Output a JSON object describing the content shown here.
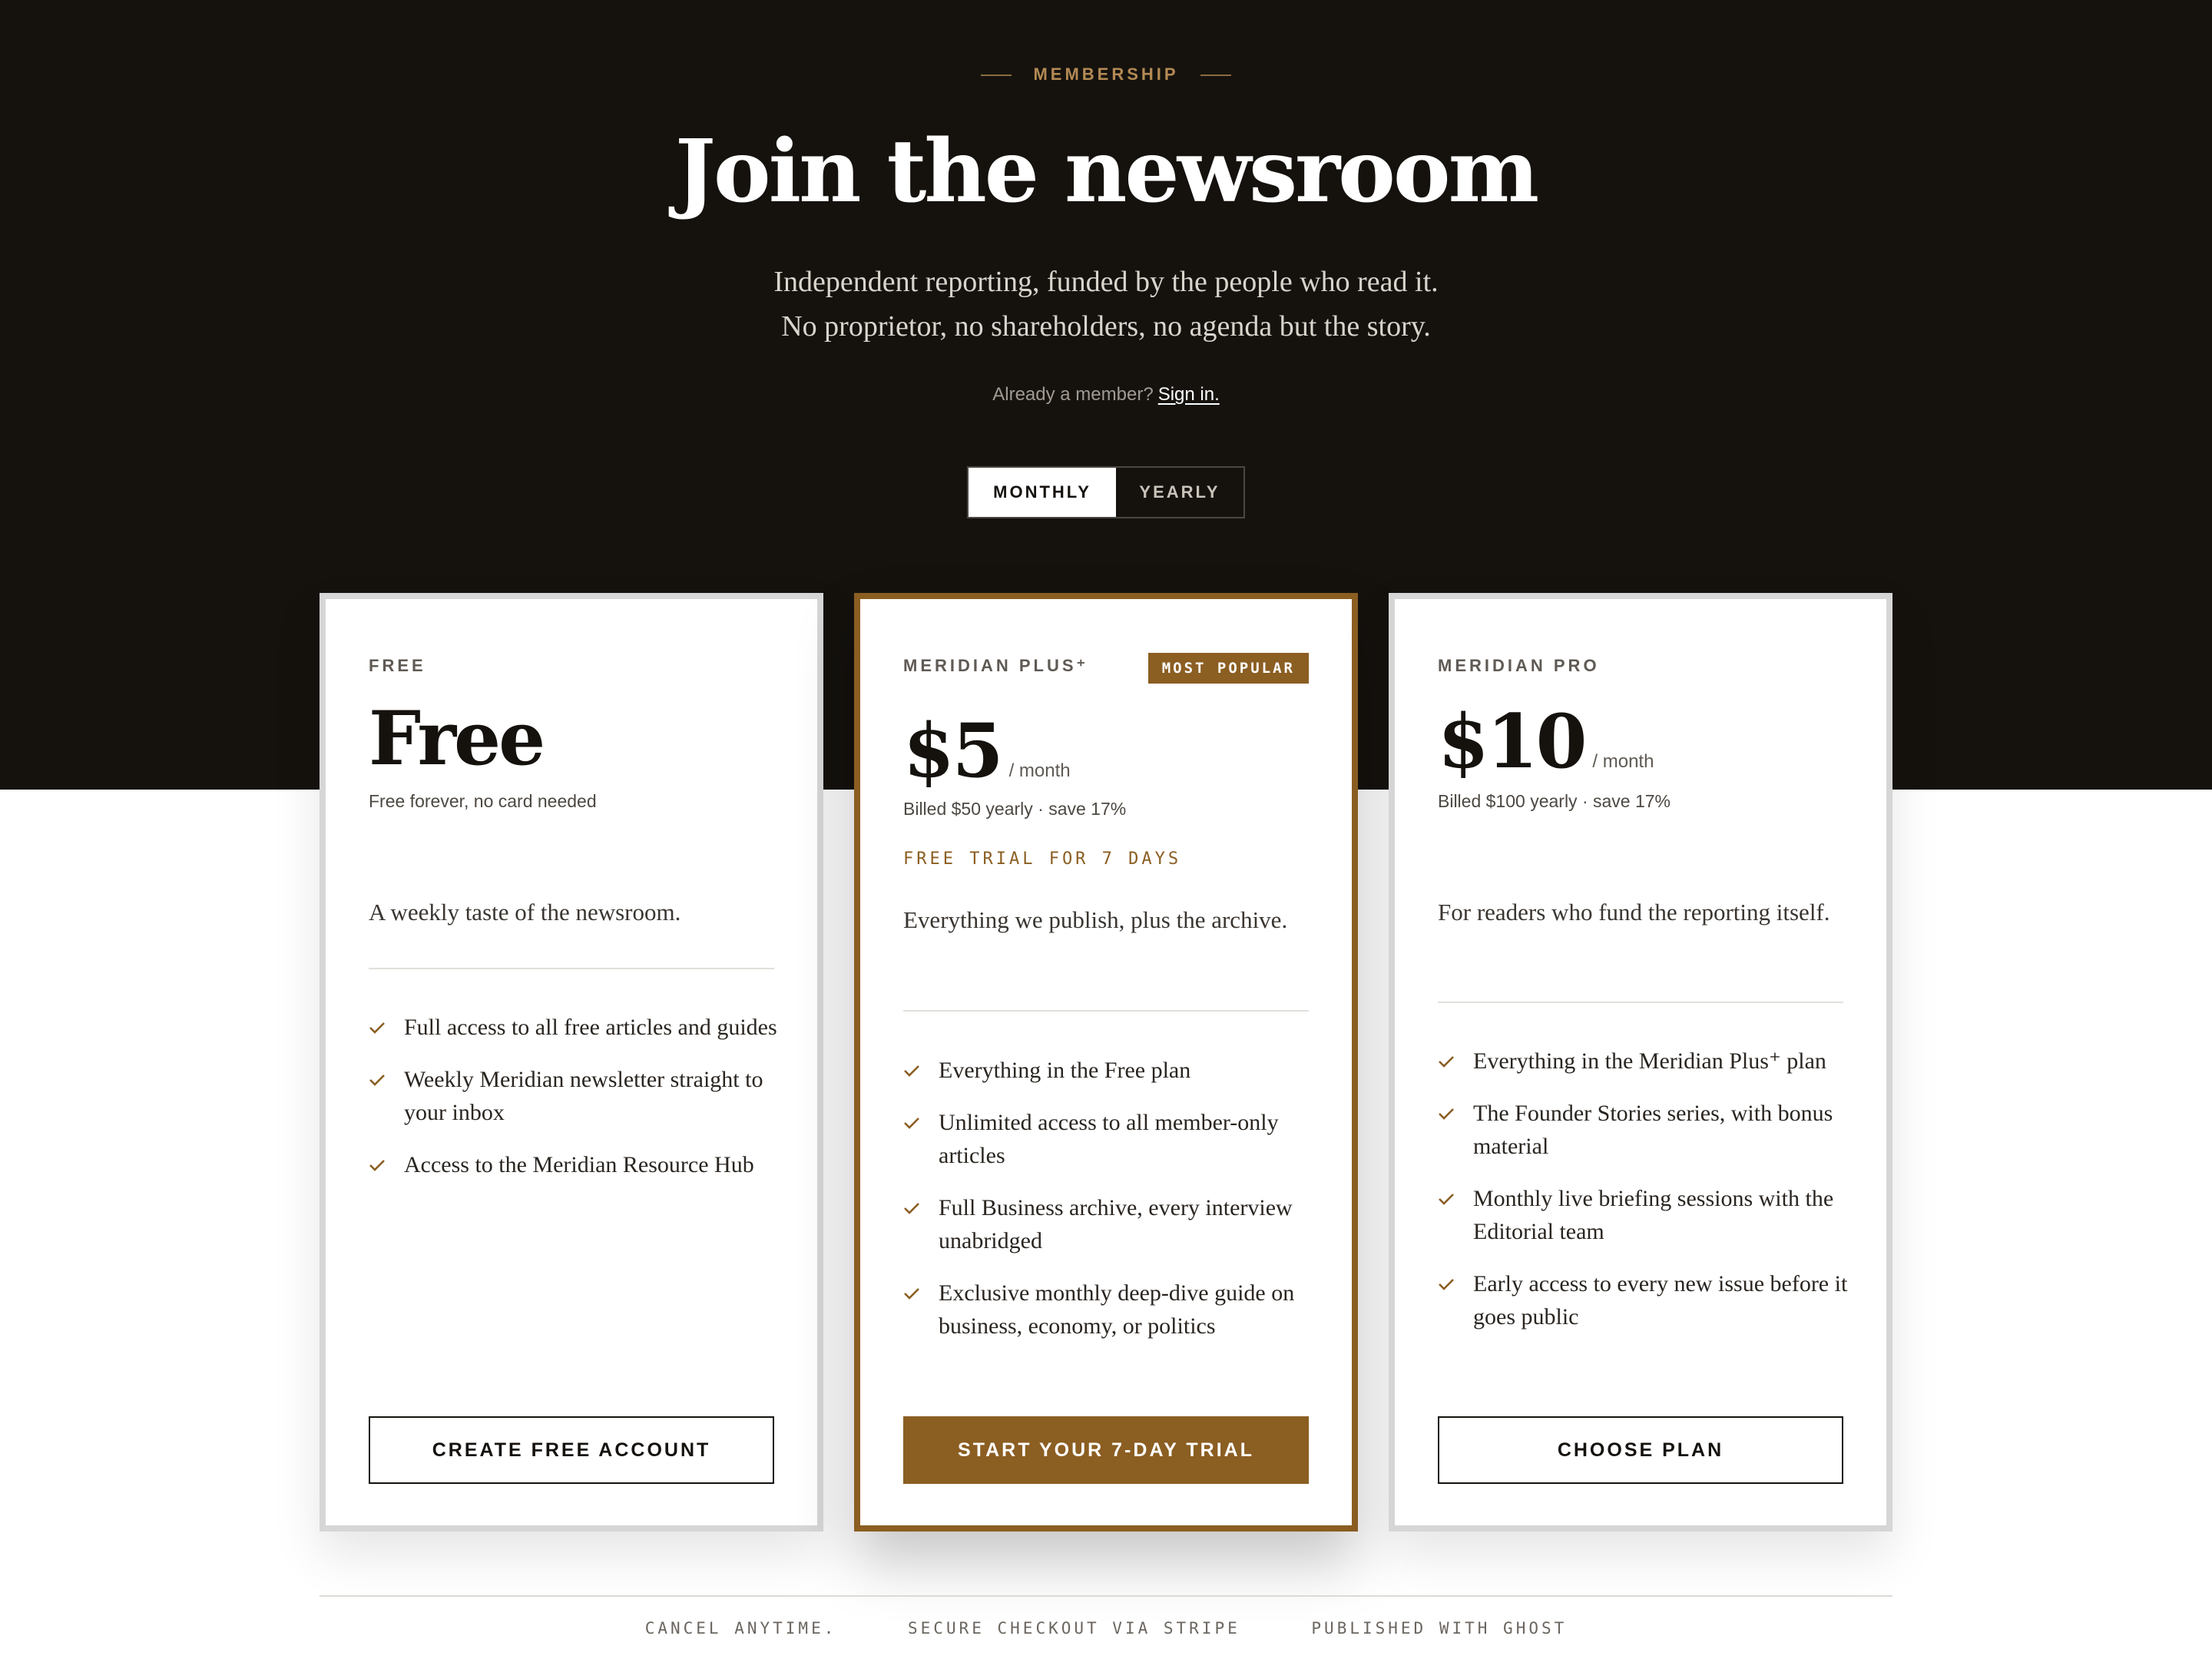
{
  "hero": {
    "eyebrow": "MEMBERSHIP",
    "title": "Join the newsroom",
    "subtitle_line1": "Independent reporting, funded by the people who read it.",
    "subtitle_line2": "No proprietor, no shareholders, no agenda but the story.",
    "signin_prompt": "Already a member?",
    "signin_link": "Sign in."
  },
  "billing_toggle": {
    "monthly": "MONTHLY",
    "yearly": "YEARLY",
    "selected": "MONTHLY"
  },
  "plans": [
    {
      "tier": "FREE",
      "price": "Free",
      "period": "",
      "billed": "Free forever, no card needed",
      "trial": "",
      "badge": "",
      "description": "A weekly taste of the newsroom.",
      "features": [
        "Full access to all free articles and guides",
        "Weekly Meridian newsletter straight to your inbox",
        "Access to the Meridian Resource Hub"
      ],
      "cta": "CREATE FREE ACCOUNT"
    },
    {
      "tier": "MERIDIAN PLUS⁺",
      "price": "$5",
      "period": "/ month",
      "billed": "Billed $50 yearly · save 17%",
      "trial": "FREE TRIAL FOR 7 DAYS",
      "badge": "MOST POPULAR",
      "description": "Everything we publish, plus the archive.",
      "features": [
        "Everything in the Free plan",
        "Unlimited access to all member-only articles",
        "Full Business archive, every interview unabridged",
        "Exclusive monthly deep-dive guide on business, economy, or politics"
      ],
      "cta": "START YOUR 7-DAY TRIAL"
    },
    {
      "tier": "MERIDIAN PRO",
      "price": "$10",
      "period": "/ month",
      "billed": "Billed $100 yearly · save 17%",
      "trial": "",
      "badge": "",
      "description": "For readers who fund the reporting itself.",
      "features": [
        "Everything in the Meridian Plus⁺ plan",
        "The Founder Stories series, with bonus material",
        "Monthly live briefing sessions with the Editorial team",
        "Early access to every new issue before it goes public"
      ],
      "cta": "CHOOSE PLAN"
    }
  ],
  "footer": {
    "item1": "CANCEL ANYTIME.",
    "item2": "SECURE CHECKOUT VIA STRIPE",
    "item3": "PUBLISHED WITH GHOST"
  },
  "colors": {
    "hero_background": "#15120e",
    "accent": "#8b5e22",
    "eyebrow": "#b48a54"
  },
  "icons": {
    "feature_bullet": "check-icon"
  }
}
